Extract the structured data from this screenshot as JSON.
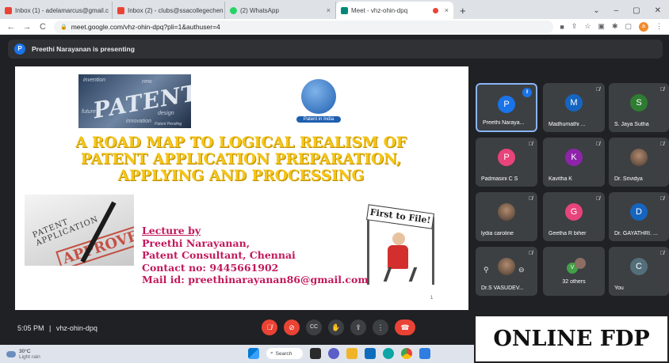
{
  "browser": {
    "tabs": [
      {
        "label": "Inbox (1) - adelamarcus@gmail.c",
        "favicon_color": "#ea4335"
      },
      {
        "label": "Inbox (2) - clubs@ssacollegechen",
        "favicon_color": "#ea4335"
      },
      {
        "label": "(2) WhatsApp",
        "favicon_color": "#25d366"
      },
      {
        "label": "Meet - vhz-ohin-dpq",
        "favicon_color": "#00897b"
      }
    ],
    "close_glyph": "×",
    "new_tab_glyph": "+",
    "window_controls": [
      "⌄",
      "–",
      "▢",
      "✕"
    ],
    "nav": {
      "back": "←",
      "forward": "→",
      "reload": "C"
    },
    "url": "meet.google.com/vhz-ohin-dpq?pli=1&authuser=4",
    "profile_initial": "a"
  },
  "banner": {
    "avatar_initial": "P",
    "text": "Preethi Narayanan is presenting"
  },
  "slide": {
    "patent_word": "PATENT",
    "patent_words": [
      "invention",
      "future",
      "design",
      "innovation",
      "new",
      "Patent Pending"
    ],
    "logo_caption": "Patent in India",
    "title_lines": [
      "A ROAD MAP TO LOGICAL REALISM OF",
      "PATENT APPLICATION PREPARATION,",
      "APPLYING AND PROCESSING"
    ],
    "app_text": "PATENT APPLICATION",
    "approved_text": "APPROVED",
    "lecture_heading": "Lecture by",
    "lecture_lines": [
      "Preethi Narayanan,",
      "Patent Consultant,  Chennai",
      "Contact no: 9445661902",
      "Mail id: preethinarayanan86@gmail.com"
    ],
    "first_to_file": "First to File!",
    "page_number": "1"
  },
  "participants": [
    {
      "name": "Preethi Naraya...",
      "initial": "P",
      "color": "#1a73e8",
      "state": "speaking"
    },
    {
      "name": "Madhumathi ...",
      "initial": "M",
      "color": "#1565c0",
      "state": "muted"
    },
    {
      "name": "S. Jaya Sutha",
      "initial": "S",
      "color": "#2e7d32",
      "state": "muted"
    },
    {
      "name": "Padmasini C S",
      "initial": "P",
      "color": "#e8437a",
      "state": "muted"
    },
    {
      "name": "Kavitha K",
      "initial": "K",
      "color": "#8e24aa",
      "state": "muted"
    },
    {
      "name": "Dr. Srividya",
      "initial": "",
      "color": "#8d6e63",
      "state": "muted"
    },
    {
      "name": "lydia caroline",
      "initial": "",
      "color": "#6d6d6d",
      "state": "muted"
    },
    {
      "name": "Geetha R biher",
      "initial": "G",
      "color": "#e8437a",
      "state": "muted"
    },
    {
      "name": "Dr. GAYATHRI. ...",
      "initial": "D",
      "color": "#1565c0",
      "state": "muted"
    },
    {
      "name": "Dr.S VASUDEV...",
      "initial": "",
      "color": "#6d6d6d",
      "state": "muted"
    },
    {
      "name": "32 others",
      "initial": "V",
      "color": "#43a047",
      "state": "group"
    },
    {
      "name": "You",
      "initial": "C",
      "color": "#546e7a",
      "state": "muted"
    }
  ],
  "icons": {
    "muted": "🎙̸",
    "speaking": "⫴",
    "pin": "⚲",
    "minus": "⊖"
  },
  "meeting": {
    "time": "5:05 PM",
    "separator": "|",
    "code": "vhz-ohin-dpq"
  },
  "controls": {
    "mic": "🎙̸",
    "camera": "⊘",
    "captions": "CC",
    "hand": "✋",
    "present": "⇪",
    "more": "⋮",
    "end": "☎"
  },
  "overlay_label": "ONLINE FDP",
  "taskbar": {
    "temp": "30°C",
    "weather": "Light rain",
    "search": "Search"
  }
}
